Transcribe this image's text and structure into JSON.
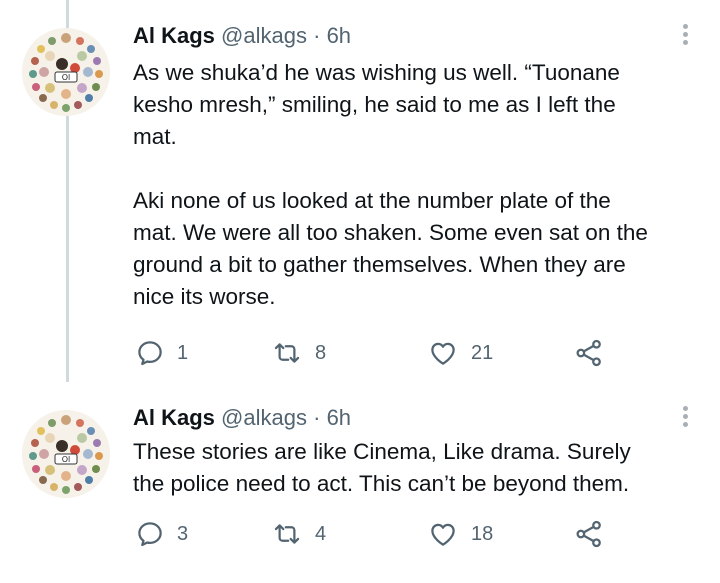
{
  "colors": {
    "text": "#0f1419",
    "secondary": "#536471",
    "thread_line": "#cfd9de"
  },
  "tweets": [
    {
      "author": {
        "name": "Al Kags",
        "handle": "@alkags",
        "separator": "·",
        "time": "6h",
        "avatar_icon": "collage-avatar"
      },
      "text_lines": [
        "As we shuka’d he was wishing us well. “Tuonane",
        "kesho mresh,” smiling, he said to me as I left the",
        "mat.",
        "Aki none of us looked at the number plate of the",
        "mat. We were all too shaken. Some even sat on the",
        "ground a bit to gather themselves. When they are",
        "nice its worse."
      ],
      "actions": {
        "replies": "1",
        "retweets": "8",
        "likes": "21"
      }
    },
    {
      "author": {
        "name": "Al Kags",
        "handle": "@alkags",
        "separator": "·",
        "time": "6h",
        "avatar_icon": "collage-avatar"
      },
      "text_lines": [
        "These stories are like Cinema, Like drama. Surely",
        "the police need to act. This can’t be beyond them."
      ],
      "actions": {
        "replies": "3",
        "retweets": "4",
        "likes": "18"
      }
    }
  ]
}
